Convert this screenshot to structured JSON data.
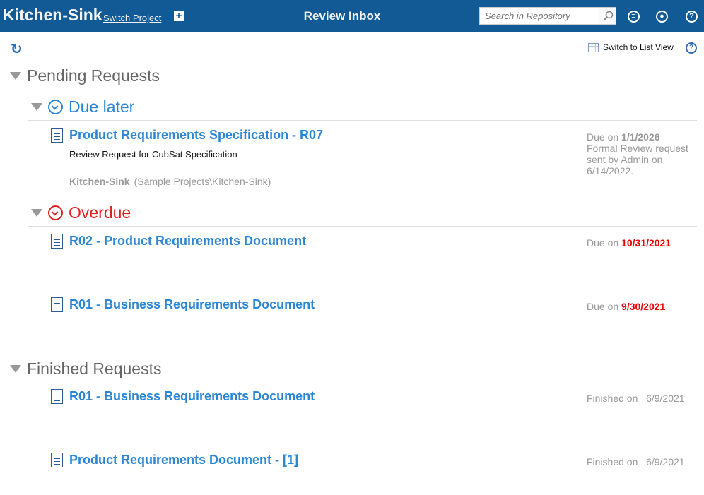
{
  "header": {
    "project": "Kitchen-Sink",
    "switch_project": "Switch Project",
    "title": "Review Inbox",
    "search_placeholder": "Search in Repository"
  },
  "toolbar": {
    "switch_view": "Switch to List View"
  },
  "pending": {
    "label": "Pending Requests",
    "due_later": {
      "label": "Due later",
      "items": [
        {
          "title": "Product Requirements Specification - R07",
          "description": "Review Request for CubSat Specification",
          "project": "Kitchen-Sink",
          "path": "(Sample Projects\\Kitchen-Sink)",
          "due_prefix": "Due on",
          "due": "1/1/2026",
          "note": "Formal Review request sent by Admin on 6/14/2022."
        }
      ]
    },
    "overdue": {
      "label": "Overdue",
      "items": [
        {
          "title": "R02 - Product Requirements Document",
          "due_prefix": "Due on",
          "due": "10/31/2021"
        },
        {
          "title": "R01 - Business Requirements Document",
          "due_prefix": "Due on",
          "due": "9/30/2021"
        }
      ]
    }
  },
  "finished": {
    "label": "Finished Requests",
    "items": [
      {
        "title": "R01 - Business Requirements Document",
        "prefix": "Finished on",
        "date": "6/9/2021"
      },
      {
        "title": "Product Requirements Document - [1]",
        "prefix": "Finished on",
        "date": "6/9/2021"
      }
    ]
  },
  "colors": {
    "header": "#115a96",
    "link": "#2b86d6",
    "overdue": "#e02020"
  }
}
